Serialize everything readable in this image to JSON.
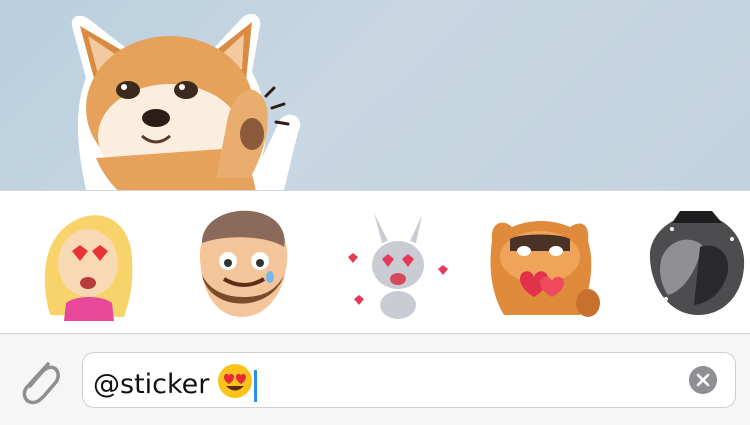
{
  "chat": {
    "sent_sticker": "shiba-dog-sticker"
  },
  "sticker_panel": {
    "items": [
      {
        "name": "blonde-girl-heart-eyes-sticker"
      },
      {
        "name": "bearded-man-tears-sticker"
      },
      {
        "name": "bunny-heart-eyes-sticker"
      },
      {
        "name": "cat-holding-hearts-sticker"
      },
      {
        "name": "couple-silhouette-sticker"
      }
    ]
  },
  "input": {
    "value": "@sticker",
    "emoji": "😍",
    "attach_icon": "paperclip-icon",
    "clear_icon": "clear-x-icon"
  },
  "colors": {
    "chat_background": "#c2d2de",
    "caret": "#2f8ce8",
    "clear_button": "#8e8e93"
  }
}
